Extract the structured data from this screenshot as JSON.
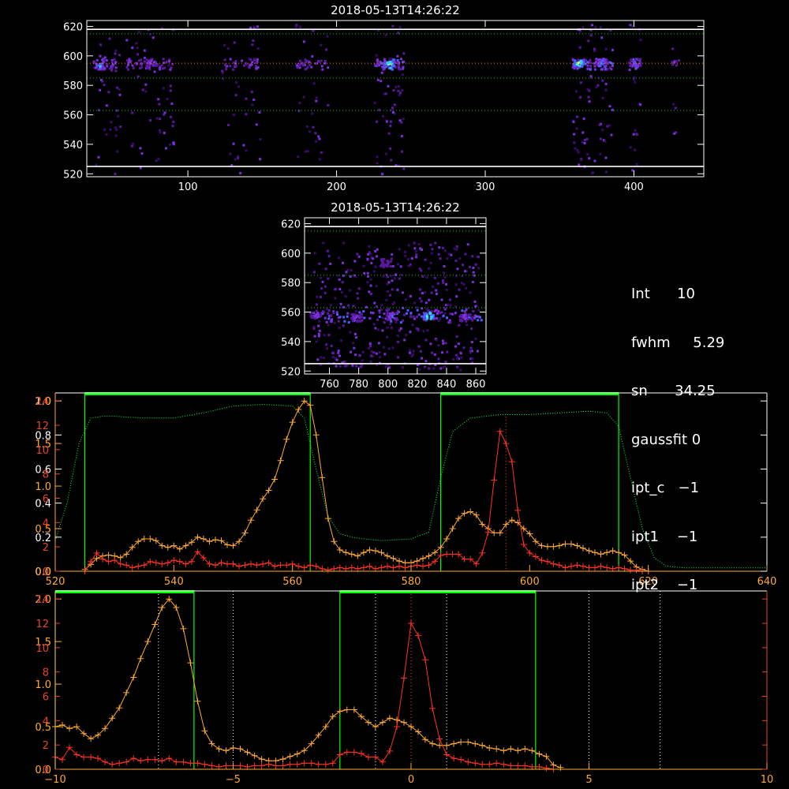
{
  "chart_data": [
    {
      "type": "heatmap",
      "title": "2018-05-13T14:26:22",
      "xlim": [
        32,
        447
      ],
      "ylim": [
        518,
        624
      ],
      "x_ticks": [
        100,
        200,
        300,
        400
      ],
      "y_ticks": [
        520,
        540,
        560,
        580,
        600,
        620
      ],
      "white_lines": [
        525,
        618
      ],
      "dotted_lines": [
        {
          "y": 615,
          "color": "#00cc00"
        },
        {
          "y": 595,
          "color": "#ff8800"
        },
        {
          "y": 585,
          "color": "#00cc00"
        },
        {
          "y": 563,
          "color": "#00cc00"
        }
      ],
      "columns": [
        {
          "x0": 36,
          "x1": 54,
          "strength": 0.6
        },
        {
          "x0": 58,
          "x1": 90,
          "strength": 0.5
        },
        {
          "x0": 122,
          "x1": 148,
          "strength": 0.45
        },
        {
          "x0": 172,
          "x1": 195,
          "strength": 0.45
        },
        {
          "x0": 225,
          "x1": 245,
          "strength": 0.9
        },
        {
          "x0": 358,
          "x1": 385,
          "strength": 0.9
        },
        {
          "x0": 396,
          "x1": 404,
          "strength": 0.7
        },
        {
          "x0": 425,
          "x1": 430,
          "strength": 0.4
        }
      ],
      "hotspots": [
        {
          "x": 40,
          "y": 594,
          "level": 0.7
        },
        {
          "x": 75,
          "y": 596,
          "level": 0.5
        },
        {
          "x": 235,
          "y": 595,
          "level": 1.0
        },
        {
          "x": 362,
          "y": 596,
          "level": 1.0
        },
        {
          "x": 378,
          "y": 596,
          "level": 0.7
        },
        {
          "x": 400,
          "y": 596,
          "level": 0.6
        }
      ]
    },
    {
      "type": "heatmap",
      "title": "2018-05-13T14:26:22",
      "xlim": [
        743,
        867
      ],
      "ylim": [
        518,
        624
      ],
      "x_ticks": [
        760,
        780,
        800,
        820,
        840,
        860
      ],
      "y_ticks": [
        520,
        540,
        560,
        580,
        600,
        620
      ],
      "white_lines": [
        525,
        618
      ],
      "dotted_lines": [
        {
          "y": 615,
          "color": "#00cc00"
        },
        {
          "y": 585,
          "color": "#00cc00"
        },
        {
          "y": 563,
          "color": "#00cc00"
        }
      ],
      "hotspots": [
        {
          "x": 750,
          "y": 559,
          "level": 0.5
        },
        {
          "x": 778,
          "y": 557,
          "level": 0.5
        },
        {
          "x": 802,
          "y": 558,
          "level": 0.6
        },
        {
          "x": 827,
          "y": 558,
          "level": 1.0
        },
        {
          "x": 852,
          "y": 557,
          "level": 0.5
        },
        {
          "x": 798,
          "y": 594,
          "level": 0.4
        }
      ]
    },
    {
      "type": "line",
      "xlim": [
        520,
        640
      ],
      "x_ticks": [
        520,
        540,
        560,
        580,
        600,
        620,
        640
      ],
      "y_white_ticks": [
        0.0,
        0.2,
        0.4,
        0.6,
        0.8,
        1.0
      ],
      "y_white_labels": [
        "0.0",
        "0.2",
        "0.4",
        "0.6",
        "0.8",
        "1.0"
      ],
      "y_yellow_ticks": [
        0.0,
        0.5,
        1.0,
        1.5,
        2.0
      ],
      "y_yellow_labels": [
        "0.0",
        "0.5",
        "1.0",
        "1.5",
        "2.0"
      ],
      "y_red_ticks": [
        0,
        2,
        4,
        6,
        8,
        10,
        12,
        14
      ],
      "y_red_labels": [
        "0",
        "2",
        "4",
        "6",
        "8",
        "10",
        "12",
        "14"
      ],
      "windows": [
        [
          525,
          563
        ],
        [
          585,
          615
        ]
      ],
      "center_dotted": 596,
      "series": [
        {
          "color": "#00ff44",
          "style": "dotted",
          "x": [
            520,
            522,
            524,
            526,
            528,
            530,
            535,
            540,
            545,
            550,
            555,
            560,
            562,
            564,
            566,
            568,
            570,
            572,
            575,
            580,
            583,
            585,
            587,
            590,
            595,
            600,
            605,
            610,
            613,
            615,
            617,
            619,
            621,
            623,
            626,
            630,
            635,
            640
          ],
          "y": [
            0.18,
            0.4,
            0.75,
            0.9,
            0.91,
            0.91,
            0.9,
            0.9,
            0.93,
            0.97,
            0.98,
            0.97,
            0.9,
            0.6,
            0.32,
            0.22,
            0.2,
            0.19,
            0.18,
            0.19,
            0.23,
            0.55,
            0.82,
            0.9,
            0.92,
            0.92,
            0.93,
            0.94,
            0.93,
            0.85,
            0.55,
            0.25,
            0.08,
            0.03,
            0.02,
            0.02,
            0.02,
            0.02
          ]
        },
        {
          "color": "#ffaa33",
          "style": "plus",
          "x": [
            525,
            526,
            527,
            528,
            529,
            530,
            531,
            532,
            533,
            534,
            535,
            536,
            537,
            538,
            539,
            540,
            541,
            542,
            543,
            544,
            545,
            546,
            547,
            548,
            549,
            550,
            551,
            552,
            553,
            554,
            555,
            556,
            557,
            558,
            559,
            560,
            561,
            562,
            563,
            564,
            565,
            566,
            567,
            568,
            569,
            570,
            571,
            572,
            573,
            574,
            575,
            576,
            577,
            578,
            579,
            580,
            581,
            582,
            583,
            584,
            585,
            586,
            587,
            588,
            589,
            590,
            591,
            592,
            593,
            594,
            595,
            596,
            597,
            598,
            599,
            600,
            601,
            602,
            603,
            604,
            605,
            606,
            607,
            608,
            609,
            610,
            611,
            612,
            613,
            614,
            615,
            616,
            617,
            618,
            619,
            620
          ],
          "y": [
            0.02,
            0.08,
            0.15,
            0.18,
            0.19,
            0.18,
            0.16,
            0.2,
            0.28,
            0.35,
            0.38,
            0.38,
            0.36,
            0.3,
            0.28,
            0.3,
            0.26,
            0.3,
            0.34,
            0.4,
            0.38,
            0.35,
            0.37,
            0.36,
            0.31,
            0.3,
            0.35,
            0.45,
            0.6,
            0.72,
            0.85,
            0.95,
            1.08,
            1.3,
            1.55,
            1.75,
            1.9,
            2.0,
            1.95,
            1.6,
            1.1,
            0.62,
            0.35,
            0.25,
            0.22,
            0.2,
            0.18,
            0.22,
            0.25,
            0.24,
            0.22,
            0.18,
            0.15,
            0.12,
            0.1,
            0.1,
            0.12,
            0.15,
            0.18,
            0.22,
            0.28,
            0.38,
            0.5,
            0.62,
            0.68,
            0.7,
            0.66,
            0.55,
            0.5,
            0.45,
            0.45,
            0.55,
            0.6,
            0.57,
            0.5,
            0.44,
            0.35,
            0.3,
            0.29,
            0.29,
            0.3,
            0.32,
            0.32,
            0.3,
            0.27,
            0.24,
            0.22,
            0.2,
            0.22,
            0.24,
            0.22,
            0.19,
            0.12,
            0.05,
            0.02,
            0.0
          ]
        },
        {
          "color": "#ff3322",
          "style": "plus",
          "x": [
            525,
            526,
            527,
            528,
            529,
            530,
            531,
            532,
            533,
            534,
            535,
            536,
            537,
            538,
            539,
            540,
            541,
            542,
            543,
            544,
            545,
            546,
            547,
            548,
            549,
            550,
            551,
            552,
            553,
            554,
            555,
            556,
            557,
            558,
            559,
            560,
            561,
            562,
            563,
            564,
            565,
            566,
            567,
            568,
            569,
            570,
            571,
            572,
            573,
            574,
            575,
            576,
            577,
            578,
            579,
            580,
            581,
            582,
            583,
            584,
            585,
            586,
            587,
            588,
            589,
            590,
            591,
            592,
            593,
            594,
            595,
            596,
            597,
            598,
            599,
            600,
            601,
            602,
            603,
            604,
            605,
            606,
            607,
            608,
            609,
            610,
            611,
            612,
            613,
            614,
            615,
            616,
            617,
            618,
            619,
            620
          ],
          "y": [
            0.0,
            0.8,
            1.5,
            1.0,
            0.8,
            0.9,
            0.6,
            0.5,
            0.3,
            0.4,
            0.5,
            0.8,
            0.7,
            0.6,
            0.7,
            0.9,
            0.8,
            0.6,
            0.8,
            1.6,
            1.1,
            0.6,
            0.5,
            0.7,
            0.6,
            0.6,
            0.4,
            0.5,
            0.6,
            0.5,
            0.6,
            0.7,
            0.4,
            0.5,
            0.5,
            0.6,
            0.4,
            0.3,
            0.5,
            0.4,
            0.2,
            0.1,
            0.2,
            0.3,
            0.2,
            0.3,
            0.2,
            0.3,
            0.4,
            0.2,
            0.3,
            0.4,
            0.3,
            0.4,
            0.3,
            0.4,
            0.5,
            0.4,
            0.5,
            0.8,
            1.3,
            1.4,
            1.4,
            1.4,
            1.0,
            1.0,
            0.6,
            1.5,
            3.2,
            7.5,
            11.5,
            10.5,
            9.0,
            5.0,
            2.2,
            1.5,
            1.2,
            0.9,
            0.8,
            0.6,
            0.5,
            0.3,
            0.4,
            0.5,
            0.4,
            0.3,
            0.3,
            0.4,
            0.3,
            0.2,
            0.3,
            0.2,
            0.1,
            0.1,
            0.0,
            0.0
          ]
        }
      ]
    },
    {
      "type": "line",
      "xlim": [
        -10,
        10
      ],
      "x_ticks": [
        -10,
        -5,
        0,
        5,
        10
      ],
      "y_yellow_ticks": [
        0.0,
        0.5,
        1.0,
        1.5,
        2.0
      ],
      "y_yellow_labels": [
        "0.0",
        "0.5",
        "1.0",
        "1.5",
        "2.0"
      ],
      "y_red_ticks": [
        0,
        2,
        4,
        6,
        8,
        10,
        12,
        14
      ],
      "y_red_labels": [
        "0",
        "2",
        "4",
        "6",
        "8",
        "10",
        "12",
        "14"
      ],
      "windows": [
        [
          -10,
          -6.1
        ],
        [
          -2.0,
          3.5
        ]
      ],
      "white_dotted": [
        -7.1,
        -5.0,
        -1.0,
        1.0,
        5.0,
        7.0
      ],
      "red_dotted": [
        0
      ],
      "series": [
        {
          "color": "#ffaa33",
          "style": "plus",
          "x": [
            -10.0,
            -9.8,
            -9.6,
            -9.4,
            -9.2,
            -9.0,
            -8.8,
            -8.6,
            -8.4,
            -8.2,
            -8.0,
            -7.8,
            -7.6,
            -7.4,
            -7.2,
            -7.0,
            -6.8,
            -6.6,
            -6.4,
            -6.2,
            -6.0,
            -5.8,
            -5.6,
            -5.4,
            -5.2,
            -5.0,
            -4.8,
            -4.6,
            -4.4,
            -4.2,
            -4.0,
            -3.8,
            -3.6,
            -3.4,
            -3.2,
            -3.0,
            -2.8,
            -2.6,
            -2.4,
            -2.2,
            -2.0,
            -1.8,
            -1.6,
            -1.4,
            -1.2,
            -1.0,
            -0.8,
            -0.6,
            -0.4,
            -0.2,
            0.0,
            0.2,
            0.4,
            0.6,
            0.8,
            1.0,
            1.2,
            1.4,
            1.6,
            1.8,
            2.0,
            2.2,
            2.4,
            2.6,
            2.8,
            3.0,
            3.2,
            3.4,
            3.6,
            3.8,
            4.0,
            4.2
          ],
          "y": [
            0.5,
            0.52,
            0.48,
            0.5,
            0.42,
            0.36,
            0.4,
            0.48,
            0.6,
            0.72,
            0.9,
            1.08,
            1.3,
            1.5,
            1.7,
            1.9,
            2.0,
            1.9,
            1.65,
            1.25,
            0.8,
            0.45,
            0.3,
            0.24,
            0.22,
            0.25,
            0.24,
            0.2,
            0.16,
            0.12,
            0.1,
            0.1,
            0.12,
            0.15,
            0.18,
            0.22,
            0.3,
            0.4,
            0.5,
            0.62,
            0.68,
            0.7,
            0.7,
            0.62,
            0.55,
            0.5,
            0.55,
            0.6,
            0.58,
            0.55,
            0.5,
            0.44,
            0.35,
            0.3,
            0.28,
            0.28,
            0.3,
            0.32,
            0.32,
            0.3,
            0.28,
            0.25,
            0.24,
            0.22,
            0.24,
            0.22,
            0.24,
            0.22,
            0.18,
            0.15,
            0.05,
            0.02
          ]
        },
        {
          "color": "#ff3322",
          "style": "plus",
          "x": [
            -10.0,
            -9.8,
            -9.6,
            -9.4,
            -9.2,
            -9.0,
            -8.8,
            -8.6,
            -8.4,
            -8.2,
            -8.0,
            -7.8,
            -7.6,
            -7.4,
            -7.2,
            -7.0,
            -6.8,
            -6.6,
            -6.4,
            -6.2,
            -6.0,
            -5.8,
            -5.6,
            -5.4,
            -5.2,
            -5.0,
            -4.8,
            -4.6,
            -4.4,
            -4.2,
            -4.0,
            -3.8,
            -3.6,
            -3.4,
            -3.2,
            -3.0,
            -2.8,
            -2.6,
            -2.4,
            -2.2,
            -2.0,
            -1.8,
            -1.6,
            -1.4,
            -1.2,
            -1.0,
            -0.8,
            -0.6,
            -0.4,
            -0.2,
            0.0,
            0.2,
            0.4,
            0.6,
            0.8,
            1.0,
            1.2,
            1.4,
            1.6,
            1.8,
            2.0,
            2.2,
            2.4,
            2.6,
            2.8,
            3.0,
            3.2,
            3.4,
            3.6,
            3.8,
            4.0
          ],
          "y": [
            1.0,
            0.8,
            1.8,
            1.2,
            1.0,
            1.0,
            0.9,
            0.6,
            0.4,
            0.5,
            0.6,
            0.9,
            0.7,
            0.8,
            0.8,
            0.7,
            0.9,
            0.6,
            0.6,
            0.5,
            0.5,
            0.4,
            0.3,
            0.2,
            0.3,
            0.3,
            0.3,
            0.2,
            0.3,
            0.3,
            0.4,
            0.3,
            0.3,
            0.4,
            0.4,
            0.5,
            0.5,
            0.4,
            0.4,
            0.5,
            1.2,
            1.4,
            1.4,
            1.3,
            1.0,
            1.0,
            0.6,
            1.5,
            3.5,
            7.5,
            12.0,
            11.0,
            9.0,
            5.0,
            2.5,
            1.2,
            0.9,
            0.8,
            0.6,
            0.5,
            0.4,
            0.4,
            0.5,
            0.4,
            0.3,
            0.3,
            0.3,
            0.2,
            0.2,
            0.1,
            0.0
          ]
        }
      ]
    }
  ],
  "info_panel": {
    "rows": [
      "Int      10",
      "fwhm     5.29",
      "sn      34.25",
      "gaussfit 0",
      "ipt_c   −1",
      "ipt1    −1",
      "ipt2    −1"
    ]
  },
  "colors": {
    "background": "#000000",
    "axis": "#ffffff",
    "red": "#ff3322",
    "orange": "#ffaa33",
    "green": "#00ff00",
    "red_axis": "#e8452a"
  }
}
